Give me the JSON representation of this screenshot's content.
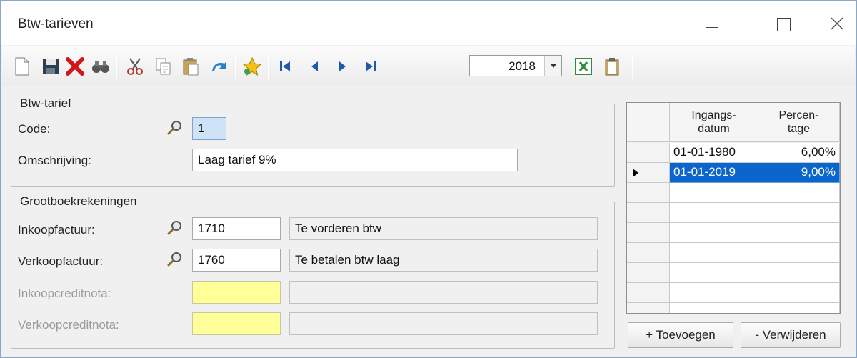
{
  "window": {
    "title": "Btw-tarieven"
  },
  "toolbar": {
    "icons": [
      "new-document-icon",
      "save-icon",
      "delete-icon",
      "binoculars-icon",
      "cut-icon",
      "copy-icon",
      "paste-icon",
      "undo-icon",
      "favorite-star-icon",
      "first-record-icon",
      "previous-record-icon",
      "next-record-icon",
      "last-record-icon",
      "excel-export-icon",
      "clipboard-icon"
    ],
    "year": {
      "value": "2018"
    }
  },
  "btw_tarief": {
    "legend": "Btw-tarief",
    "code_label": "Code:",
    "code_value": "1",
    "omschrijving_label": "Omschrijving:",
    "omschrijving_value": "Laag tarief 9%"
  },
  "grootboek": {
    "legend": "Grootboekrekeningen",
    "inkoopfactuur_label": "Inkoopfactuur:",
    "inkoopfactuur_code": "1710",
    "inkoopfactuur_desc": "Te vorderen btw",
    "verkoopfactuur_label": "Verkoopfactuur:",
    "verkoopfactuur_code": "1760",
    "verkoopfactuur_desc": "Te betalen btw laag",
    "inkoopcreditnota_label": "Inkoopcreditnota:",
    "inkoopcreditnota_code": "",
    "inkoopcreditnota_desc": "",
    "verkoopcreditnota_label": "Verkoopcreditnota:",
    "verkoopcreditnota_code": "",
    "verkoopcreditnota_desc": ""
  },
  "grid": {
    "columns": [
      {
        "line1": "Ingangs-",
        "line2": "datum"
      },
      {
        "line1": "Percen-",
        "line2": "tage"
      }
    ],
    "rows": [
      {
        "date": "01-01-1980",
        "pct": "6,00%"
      },
      {
        "date": "01-01-2019",
        "pct": "9,00%"
      }
    ]
  },
  "buttons": {
    "toevoegen": "+ Toevoegen",
    "verwijderen": "- Verwijderen"
  },
  "colors": {
    "selection": "#0a66cc",
    "required_field": "#ffff99",
    "code_field": "#cfe3f7"
  }
}
